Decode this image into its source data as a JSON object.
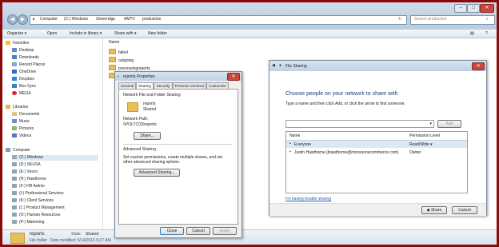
{
  "explorer": {
    "breadcrumb": [
      "Computer",
      "(C:) Windows",
      "Stoneridge",
      "AMTV",
      "production"
    ],
    "search_placeholder": "Search production",
    "toolbar": [
      "Organize ▾",
      "Open",
      "Include in library ▾",
      "Share with ▾",
      "New folder"
    ],
    "column_name": "Name",
    "nav": {
      "favorites_header": "Favorites",
      "favorites": [
        "Desktop",
        "Downloads",
        "Recent Places",
        "OneDrive",
        "Dropbox",
        "Box Sync",
        "MEGA"
      ],
      "libraries_header": "Libraries",
      "libraries": [
        "Documents",
        "Music",
        "Pictures",
        "Videos"
      ],
      "computer_header": "Computer",
      "drives": [
        "(C:) Windows",
        "(D:) SKUSA",
        "(E:) Vesco",
        "(H:) Hawthorne",
        "(F:) HR Admin",
        "(I:) Professional Services",
        "(K:) Client Services",
        "(L:) Product Management",
        "(O:) Human Resources",
        "(P:) Marketing"
      ]
    },
    "files": [
      "failed",
      "outgoing",
      "processingreports",
      "reports"
    ],
    "status": {
      "name": "reports",
      "type": "File folder",
      "state_label": "State:",
      "state_value": "Shared",
      "modified": "Date modified: 5/14/2015 9:27 AM"
    }
  },
  "properties": {
    "title": "reports Properties",
    "tabs": [
      "General",
      "Sharing",
      "Security",
      "Previous Versions",
      "Customize"
    ],
    "section1": "Network File and Folder Sharing",
    "folder_name": "reports",
    "folder_state": "Shared",
    "network_path_label": "Network Path:",
    "network_path": "\\\\POLTC03\\reports",
    "share_button": "Share...",
    "section2": "Advanced Sharing",
    "advanced_text": "Set custom permissions, create multiple shares, and set other advanced sharing options.",
    "advanced_button": "Advanced Sharing...",
    "close": "Close",
    "cancel": "Cancel",
    "apply": "Apply"
  },
  "file_sharing": {
    "title": "File Sharing",
    "heading": "Choose people on your network to share with",
    "instruction": "Type a name and then click Add, or click the arrow to find someone.",
    "add_button": "Add",
    "col_name": "Name",
    "col_permission": "Permission Level",
    "rows": [
      {
        "name": "Everyone",
        "permission": "Read/Write ▾"
      },
      {
        "name": "Justin Hawthorne (jhawthorne@monsoonecommerce.com)",
        "permission": "Owner"
      }
    ],
    "trouble_link": "I'm having trouble sharing",
    "share_button": "Share",
    "cancel_button": "Cancel"
  }
}
